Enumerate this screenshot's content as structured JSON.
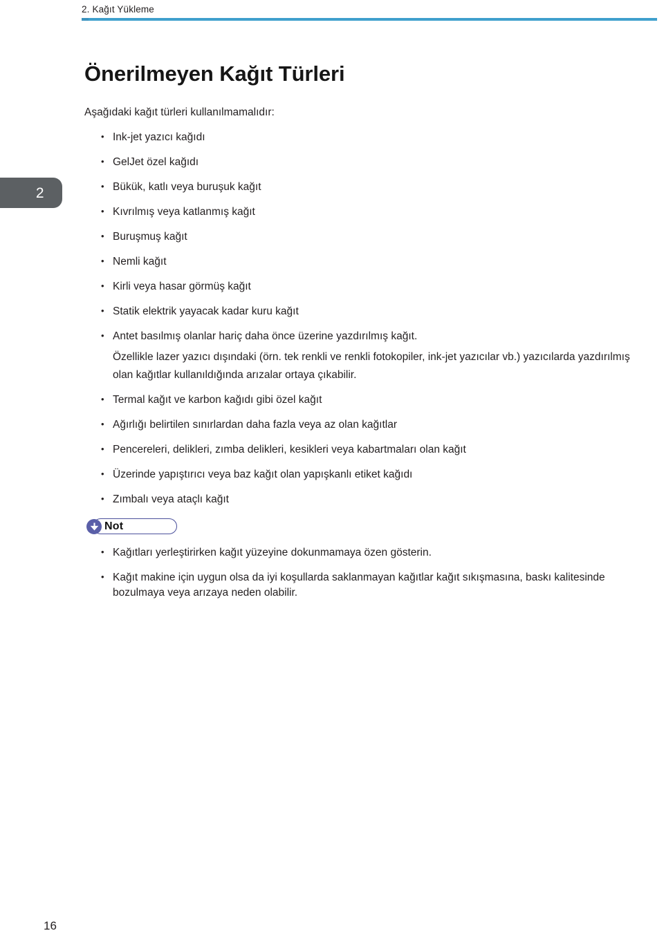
{
  "header": {
    "chapter_title": "2. Kağıt Yükleme",
    "rule_color": "#3fa0cd"
  },
  "chapter_tab": {
    "number": "2",
    "background_color": "#5c6063"
  },
  "main": {
    "title": "Önerilmeyen Kağıt Türleri",
    "intro": "Aşağıdaki kağıt türleri kullanılmamalıdır:",
    "bullets_part1": [
      "Ink-jet yazıcı kağıdı",
      "GelJet özel kağıdı",
      "Bükük, katlı veya buruşuk kağıt",
      "Kıvrılmış veya katlanmış kağıt",
      "Buruşmuş kağıt",
      "Nemli kağıt",
      "Kirli veya hasar görmüş kağıt",
      "Statik elektrik yayacak kadar kuru kağıt",
      "Antet basılmış olanlar hariç daha önce üzerine yazdırılmış kağıt."
    ],
    "sub_paragraph": "Özellikle lazer yazıcı dışındaki (örn. tek renkli ve renkli fotokopiler, ink-jet yazıcılar vb.) yazıcılarda yazdırılmış olan kağıtlar kullanıldığında arızalar ortaya çıkabilir.",
    "bullets_part2": [
      "Termal kağıt ve karbon kağıdı gibi özel kağıt",
      "Ağırlığı belirtilen sınırlardan daha fazla veya az olan kağıtlar",
      "Pencereleri, delikleri, zımba delikleri, kesikleri veya kabartmaları olan kağıt",
      "Üzerinde yapıştırıcı veya baz kağıt olan yapışkanlı etiket kağıdı",
      "Zımbalı veya ataçlı kağıt"
    ],
    "note": {
      "label": "Not",
      "icon": "down-arrow-icon",
      "icon_color": "#5a5fa8",
      "border_color": "#4a4f9b"
    },
    "note_bullets": [
      "Kağıtları yerleştirirken kağıt yüzeyine dokunmamaya özen gösterin.",
      "Kağıt makine için uygun olsa da iyi koşullarda saklanmayan kağıtlar kağıt sıkışmasına, baskı kalitesinde bozulmaya veya arızaya neden olabilir."
    ]
  },
  "footer": {
    "page_number": "16"
  }
}
